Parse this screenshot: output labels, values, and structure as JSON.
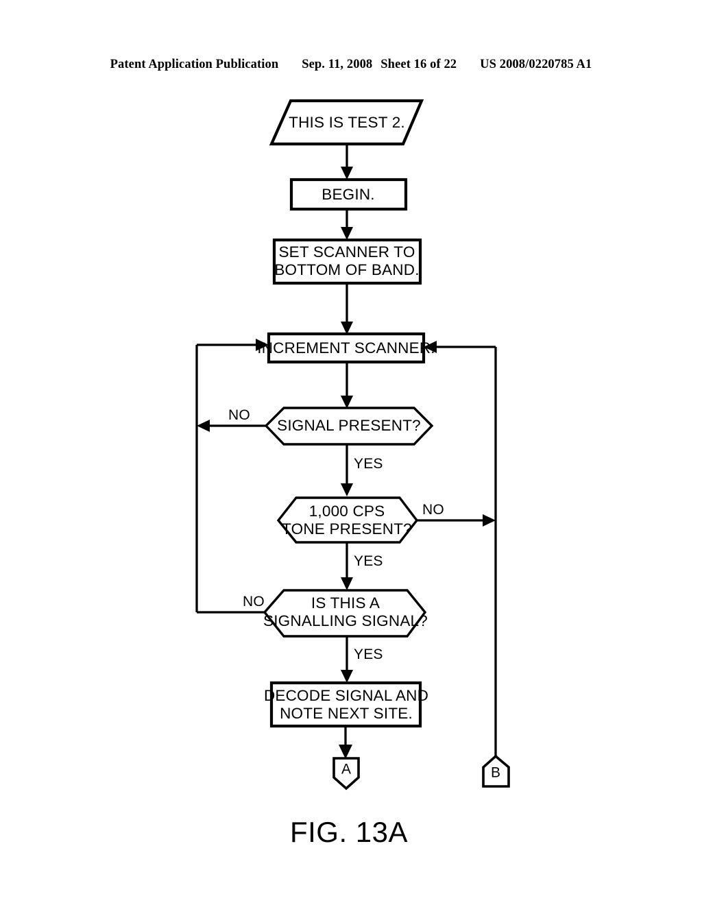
{
  "header": {
    "publication": "Patent Application Publication",
    "date": "Sep. 11, 2008",
    "sheet": "Sheet 16 of 22",
    "doc_number": "US 2008/0220785 A1"
  },
  "figure": {
    "caption": "FIG. 13A"
  },
  "flowchart": {
    "nodes": {
      "title_io": {
        "shape": "parallelogram",
        "lines": [
          "THIS IS TEST 2."
        ]
      },
      "begin": {
        "shape": "rectangle",
        "lines": [
          "BEGIN."
        ]
      },
      "set_scanner": {
        "shape": "rectangle",
        "lines": [
          "SET SCANNER TO",
          "BOTTOM OF BAND."
        ]
      },
      "increment_scanner": {
        "shape": "rectangle",
        "lines": [
          "INCREMENT SCANNER."
        ]
      },
      "signal_present": {
        "shape": "hexagon",
        "lines": [
          "SIGNAL PRESENT?"
        ]
      },
      "tone_present": {
        "shape": "hexagon",
        "lines": [
          "1,000 CPS",
          "TONE PRESENT?"
        ]
      },
      "signalling_signal": {
        "shape": "hexagon",
        "lines": [
          "IS THIS A",
          "SIGNALLING SIGNAL?"
        ]
      },
      "decode_signal": {
        "shape": "rectangle",
        "lines": [
          "DECODE SIGNAL AND",
          "NOTE NEXT SITE."
        ]
      },
      "connector_a": {
        "shape": "shield-down",
        "label": "A"
      },
      "connector_b": {
        "shape": "pentagon-up",
        "label": "B"
      }
    },
    "edge_labels": {
      "signal_present_no": "NO",
      "signal_present_yes": "YES",
      "tone_present_no": "NO",
      "tone_present_yes": "YES",
      "signalling_no": "NO",
      "signalling_yes": "YES"
    }
  },
  "colors": {
    "ink": "#000000",
    "paper": "#ffffff"
  }
}
